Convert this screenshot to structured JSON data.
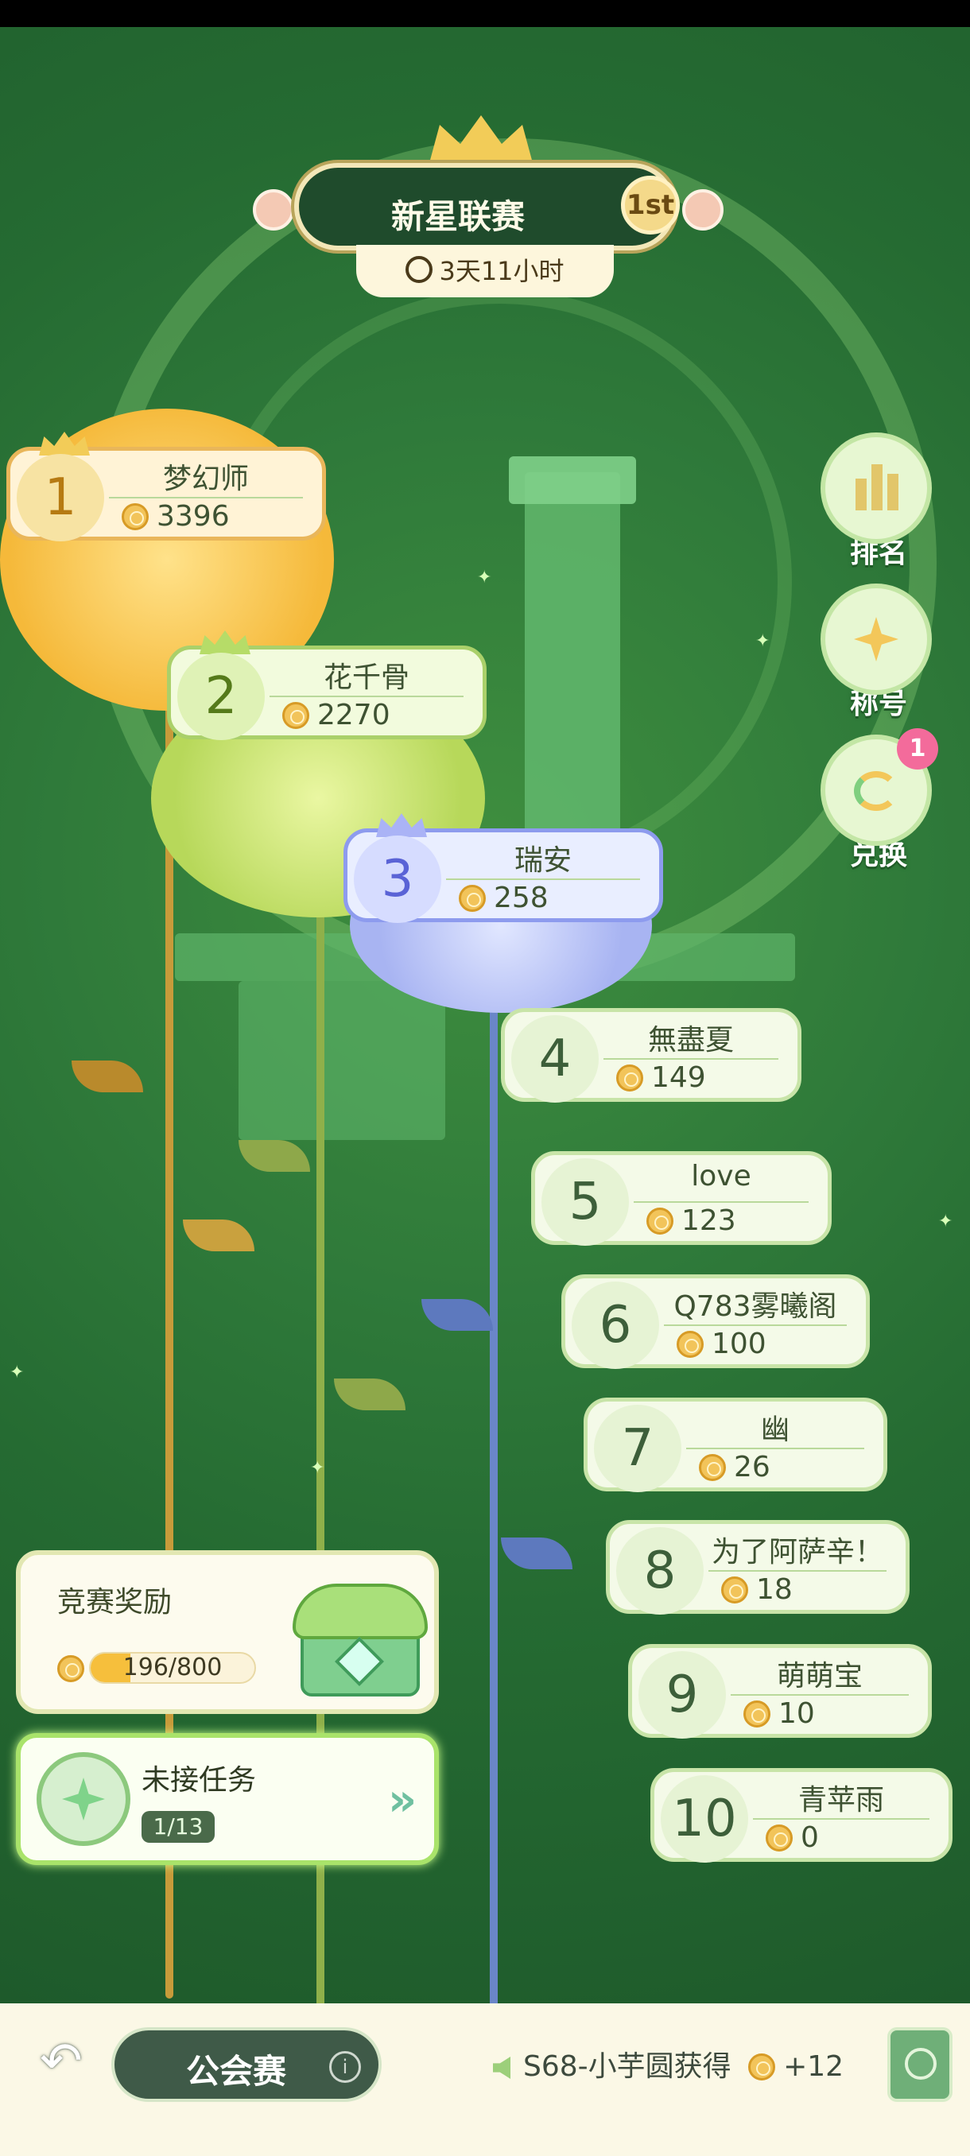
{
  "header": {
    "title": "新星联赛",
    "rank_badge": "1st",
    "timer": "3天11小时"
  },
  "side_menu": [
    {
      "label": "排名",
      "icon": "bar-chart-icon"
    },
    {
      "label": "称号",
      "icon": "star-badge-icon"
    },
    {
      "label": "兑换",
      "icon": "exchange-icon",
      "badge": "1"
    }
  ],
  "rankings": [
    {
      "rank": "1",
      "name": "梦幻师",
      "score": "3396"
    },
    {
      "rank": "2",
      "name": "花千骨",
      "score": "2270"
    },
    {
      "rank": "3",
      "name": "瑞安",
      "score": "258"
    },
    {
      "rank": "4",
      "name": "無盡夏",
      "score": "149"
    },
    {
      "rank": "5",
      "name": "love",
      "score": "123"
    },
    {
      "rank": "6",
      "name": "Q783雾曦阁",
      "score": "100"
    },
    {
      "rank": "7",
      "name": "幽",
      "score": "26"
    },
    {
      "rank": "8",
      "name": "为了阿萨辛！",
      "score": "18"
    },
    {
      "rank": "9",
      "name": "萌萌宝",
      "score": "10"
    },
    {
      "rank": "10",
      "name": "青苹雨",
      "score": "0"
    }
  ],
  "reward": {
    "title": "竞赛奖励",
    "progress_text": "196/800",
    "progress_fraction": 0.245
  },
  "task": {
    "title": "未接任务",
    "progress": "1/13"
  },
  "footer": {
    "league_label": "公会赛",
    "info_label": "i",
    "ticker_text": "S68-小芋圆获得",
    "ticker_reward": "+12"
  },
  "colors": {
    "background": "#2f7a3a",
    "gold": "#f2c45a",
    "accent_green": "#a9e36a",
    "badge_pink": "#f36b9b"
  }
}
